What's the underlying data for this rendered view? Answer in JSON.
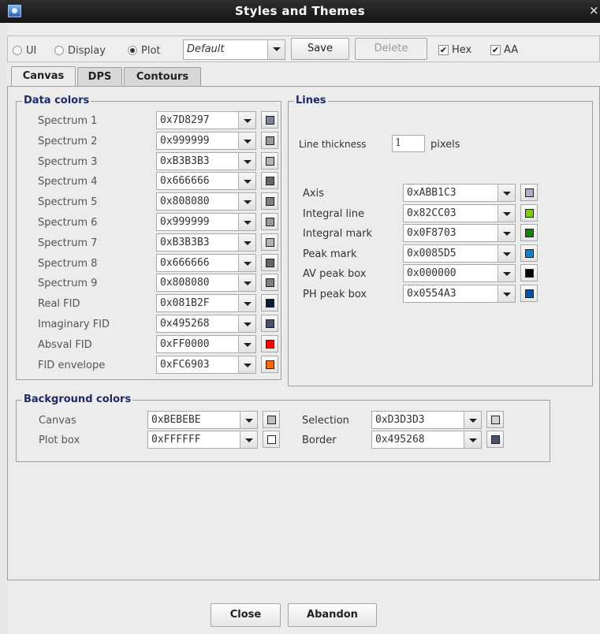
{
  "window": {
    "title": "Styles and Themes",
    "close_glyph": "×"
  },
  "toolbar": {
    "radios": [
      {
        "label": "UI",
        "selected": false
      },
      {
        "label": "Display",
        "selected": false
      },
      {
        "label": "Plot",
        "selected": true
      }
    ],
    "theme_value": "Default",
    "save_label": "Save",
    "delete_label": "Delete",
    "hex_label": "Hex",
    "hex_checked": true,
    "aa_label": "AA",
    "aa_checked": true,
    "check_glyph": "✔"
  },
  "tabs": [
    {
      "label": "Canvas",
      "active": true
    },
    {
      "label": "DPS",
      "active": false
    },
    {
      "label": "Contours",
      "active": false
    }
  ],
  "data_colors": {
    "title": "Data colors",
    "rows": [
      {
        "label": "Spectrum 1",
        "value": "0x7D8297",
        "color": "#7D8297"
      },
      {
        "label": "Spectrum 2",
        "value": "0x999999",
        "color": "#999999"
      },
      {
        "label": "Spectrum 3",
        "value": "0xB3B3B3",
        "color": "#B3B3B3"
      },
      {
        "label": "Spectrum 4",
        "value": "0x666666",
        "color": "#666666"
      },
      {
        "label": "Spectrum 5",
        "value": "0x808080",
        "color": "#808080"
      },
      {
        "label": "Spectrum 6",
        "value": "0x999999",
        "color": "#999999"
      },
      {
        "label": "Spectrum 7",
        "value": "0xB3B3B3",
        "color": "#B3B3B3"
      },
      {
        "label": "Spectrum 8",
        "value": "0x666666",
        "color": "#666666"
      },
      {
        "label": "Spectrum 9",
        "value": "0x808080",
        "color": "#808080"
      },
      {
        "label": "Real FID",
        "value": "0x081B2F",
        "color": "#081B2F"
      },
      {
        "label": "Imaginary FID",
        "value": "0x495268",
        "color": "#495268"
      },
      {
        "label": "Absval FID",
        "value": "0xFF0000",
        "color": "#FF0000"
      },
      {
        "label": "FID envelope",
        "value": "0xFC6903",
        "color": "#FC6903"
      }
    ]
  },
  "lines": {
    "title": "Lines",
    "thickness_label": "Line thickness",
    "thickness_value": "1",
    "thickness_unit": "pixels",
    "rows": [
      {
        "label": "Axis",
        "value": "0xABB1C3",
        "color": "#ABB1C3"
      },
      {
        "label": "Integral line",
        "value": "0x82CC03",
        "color": "#82CC03"
      },
      {
        "label": "Integral mark",
        "value": "0x0F8703",
        "color": "#0F8703"
      },
      {
        "label": "Peak mark",
        "value": "0x0085D5",
        "color": "#0085D5"
      },
      {
        "label": "AV peak box",
        "value": "0x000000",
        "color": "#000000"
      },
      {
        "label": "PH peak box",
        "value": "0x0554A3",
        "color": "#0554A3"
      }
    ]
  },
  "background_colors": {
    "title": "Background colors",
    "left": [
      {
        "label": "Canvas",
        "value": "0xBEBEBE",
        "color": "#BEBEBE"
      },
      {
        "label": "Plot box",
        "value": "0xFFFFFF",
        "color": "#FFFFFF"
      }
    ],
    "right": [
      {
        "label": "Selection",
        "value": "0xD3D3D3",
        "color": "#D3D3D3"
      },
      {
        "label": "Border",
        "value": "0x495268",
        "color": "#495268"
      }
    ]
  },
  "footer": {
    "close_label": "Close",
    "abandon_label": "Abandon"
  }
}
